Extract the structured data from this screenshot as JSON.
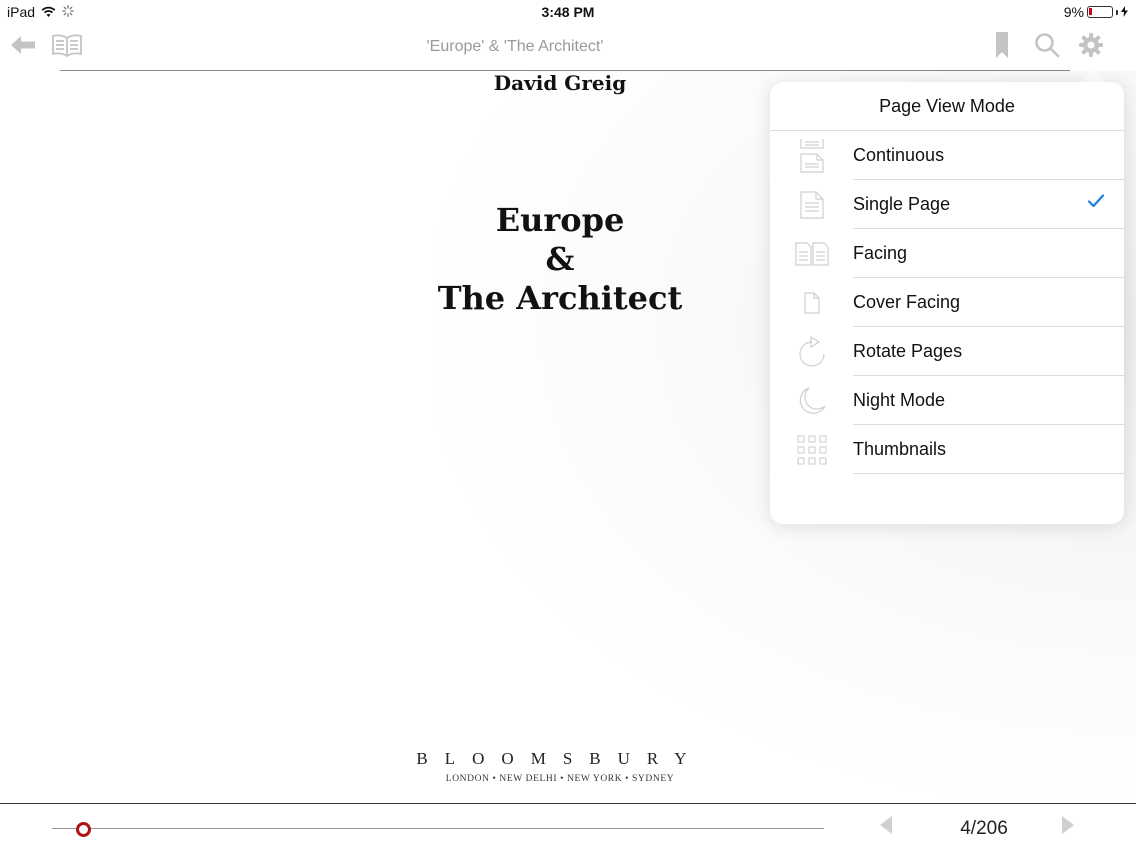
{
  "status_bar": {
    "device": "iPad",
    "time": "3:48 PM",
    "battery": "9%"
  },
  "toolbar": {
    "title": "'Europe' & 'The Architect'",
    "back_icon": "back-arrow-icon",
    "library_icon": "open-book-icon",
    "bookmark_icon": "bookmark-icon",
    "search_icon": "search-icon",
    "settings_icon": "gear-icon"
  },
  "page": {
    "author": "David Greig",
    "title_lines": [
      "Europe",
      "&",
      "The Architect"
    ],
    "publisher": "BLOOMSBURY",
    "publisher_cities": "LONDON • NEW DELHI • NEW YORK • SYDNEY"
  },
  "popover": {
    "title": "Page View Mode",
    "items": [
      {
        "label": "Continuous",
        "icon": "continuous-pages-icon",
        "selected": false
      },
      {
        "label": "Single Page",
        "icon": "single-page-icon",
        "selected": true
      },
      {
        "label": "Facing",
        "icon": "facing-pages-icon",
        "selected": false
      },
      {
        "label": "Cover Facing",
        "icon": "cover-page-icon",
        "selected": false
      },
      {
        "label": "Rotate Pages",
        "icon": "rotate-icon",
        "selected": false
      },
      {
        "label": "Night Mode",
        "icon": "moon-icon",
        "selected": false
      },
      {
        "label": "Thumbnails",
        "icon": "grid-icon",
        "selected": false
      }
    ],
    "check_icon": "checkmark-icon",
    "check_color": "#1a7ee6"
  },
  "bottom_bar": {
    "page_indicator": "4/206",
    "progress": 0.019,
    "thumb_color": "#b11313"
  }
}
